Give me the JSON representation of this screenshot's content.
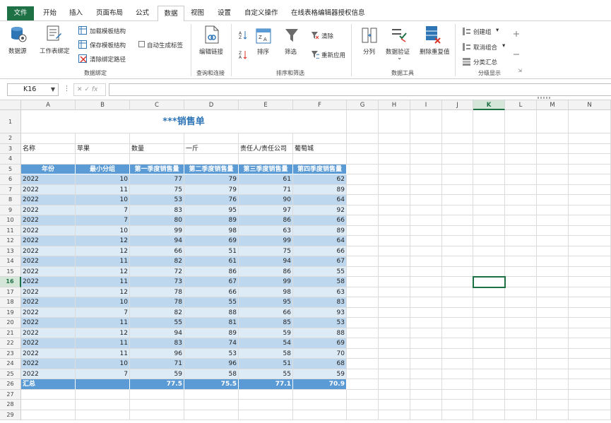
{
  "menu": {
    "file": "文件",
    "tabs": [
      "开始",
      "插入",
      "页面布局",
      "公式",
      "数据",
      "视图",
      "设置",
      "自定义操作",
      "在线表格编辑器授权信息"
    ],
    "active": "数据"
  },
  "ribbon": {
    "datasource": "数据源",
    "worksheet_bind": "工作表绑定",
    "load_template": "加载模板结构",
    "save_template": "保存模板结构",
    "clear_bind_path": "清除绑定路径",
    "auto_label": "自动生成标签",
    "group_data_bind": "数据绑定",
    "edit_link": "编辑链接",
    "group_query": "查询和连接",
    "sort": "排序",
    "filter": "筛选",
    "clear": "清除",
    "reapply": "重新应用",
    "group_sort_filter": "排序和筛选",
    "split": "分列",
    "data_validation": "数据验证",
    "remove_dup": "删除重复值",
    "group_tools": "数据工具",
    "create_group": "创建组",
    "ungroup": "取消组合",
    "subtotal": "分类汇总",
    "group_outline": "分级显示"
  },
  "formula_bar": {
    "name_box": "K16",
    "fx": "fx",
    "value": ""
  },
  "columns": [
    "A",
    "B",
    "C",
    "D",
    "E",
    "F",
    "G",
    "H",
    "I",
    "J",
    "K",
    "L",
    "M",
    "N"
  ],
  "selected_col": "K",
  "selected_row": 16,
  "sheet": {
    "title": "***销售单",
    "info_row": [
      "名称",
      "苹果",
      "数量",
      "一斤",
      "责任人/责任公司",
      "葡萄城"
    ],
    "headers": [
      "年份",
      "最小分组",
      "第一季度销售量",
      "第二季度销售量",
      "第三季度销售量",
      "第四季度销售量"
    ],
    "rows": [
      [
        "2022",
        "10",
        "77",
        "79",
        "61",
        "62"
      ],
      [
        "2022",
        "11",
        "75",
        "79",
        "71",
        "89"
      ],
      [
        "2022",
        "10",
        "53",
        "76",
        "90",
        "64"
      ],
      [
        "2022",
        "7",
        "83",
        "95",
        "97",
        "92"
      ],
      [
        "2022",
        "7",
        "80",
        "89",
        "86",
        "66"
      ],
      [
        "2022",
        "10",
        "99",
        "98",
        "63",
        "89"
      ],
      [
        "2022",
        "12",
        "94",
        "69",
        "99",
        "64"
      ],
      [
        "2022",
        "12",
        "66",
        "51",
        "75",
        "66"
      ],
      [
        "2022",
        "11",
        "82",
        "61",
        "94",
        "67"
      ],
      [
        "2022",
        "12",
        "72",
        "86",
        "86",
        "55"
      ],
      [
        "2022",
        "11",
        "73",
        "67",
        "99",
        "58"
      ],
      [
        "2022",
        "12",
        "78",
        "66",
        "98",
        "63"
      ],
      [
        "2022",
        "10",
        "78",
        "55",
        "95",
        "83"
      ],
      [
        "2022",
        "7",
        "82",
        "88",
        "66",
        "93"
      ],
      [
        "2022",
        "11",
        "55",
        "81",
        "85",
        "53"
      ],
      [
        "2022",
        "12",
        "94",
        "89",
        "59",
        "88"
      ],
      [
        "2022",
        "11",
        "83",
        "74",
        "54",
        "69"
      ],
      [
        "2022",
        "11",
        "96",
        "53",
        "58",
        "70"
      ],
      [
        "2022",
        "10",
        "71",
        "96",
        "51",
        "68"
      ],
      [
        "2022",
        "7",
        "59",
        "58",
        "55",
        "59"
      ]
    ],
    "total_label": "汇总",
    "totals": [
      "",
      "77.5",
      "75.5",
      "77.1",
      "70.9"
    ]
  },
  "colors": {
    "accent_green": "#1e7145",
    "header_blue": "#5b9bd5",
    "band_dark": "#bdd7ee",
    "band_light": "#ddebf7",
    "title_blue": "#2e75b6"
  }
}
